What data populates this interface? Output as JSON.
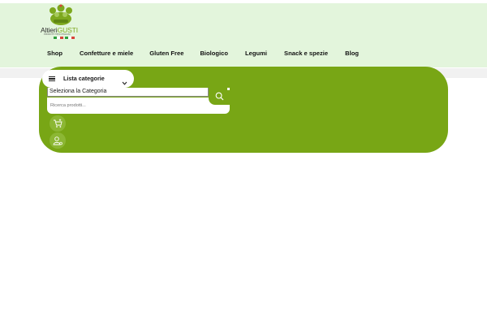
{
  "brand": {
    "name_part1": "Altieri",
    "name_part2": "GUSTI",
    "tagline": "PRODOTTI TIPICI ITALIANI",
    "icon": "crown-logo-icon",
    "accent_color": "#78a615",
    "header_bg": "#e3f5dc"
  },
  "nav": {
    "items": [
      {
        "label": "Shop"
      },
      {
        "label": "Confetture e miele"
      },
      {
        "label": "Gluten Free"
      },
      {
        "label": "Biologico"
      },
      {
        "label": "Legumi"
      },
      {
        "label": "Snack e spezie"
      },
      {
        "label": "Blog"
      }
    ]
  },
  "categories": {
    "label": "Lista categorie",
    "icon": "menu-icon",
    "chevron_icon": "chevron-down-icon"
  },
  "search": {
    "category_select": "Seleziona la Categoria",
    "placeholder": "Ricerca prodotti...",
    "button_icon": "search-icon"
  },
  "actions": {
    "cart_icon": "cart-icon",
    "account_icon": "user-icon"
  }
}
